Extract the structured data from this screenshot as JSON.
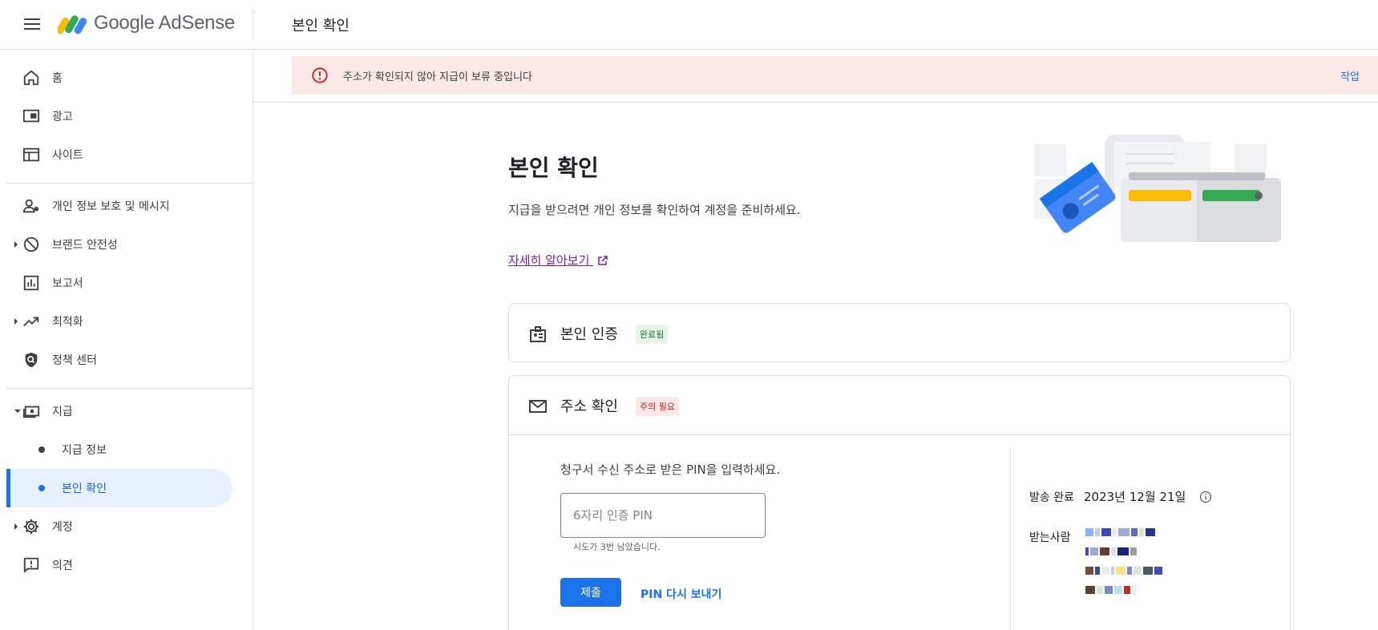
{
  "header": {
    "brand": "Google AdSense",
    "page_title": "본인 확인"
  },
  "sidebar": {
    "items": [
      {
        "label": "홈",
        "icon": "home-icon"
      },
      {
        "label": "광고",
        "icon": "ads-icon"
      },
      {
        "label": "사이트",
        "icon": "sites-icon"
      },
      {
        "label": "개인 정보 보호 및 메시지",
        "icon": "privacy-icon"
      },
      {
        "label": "브랜드 안전성",
        "icon": "block-icon"
      },
      {
        "label": "보고서",
        "icon": "reports-icon"
      },
      {
        "label": "최적화",
        "icon": "trending-icon"
      },
      {
        "label": "정책 센터",
        "icon": "policy-shield-icon"
      },
      {
        "label": "지급",
        "icon": "payments-icon"
      },
      {
        "label": "지급 정보"
      },
      {
        "label": "본인 확인"
      },
      {
        "label": "계정",
        "icon": "gear-icon"
      },
      {
        "label": "의견",
        "icon": "feedback-icon"
      }
    ]
  },
  "alert": {
    "text": "주소가 확인되지 않아 지급이 보류 중입니다",
    "action": "작업"
  },
  "main": {
    "title": "본인 확인",
    "description": "지급을 받으려면 개인 정보를 확인하여 계정을 준비하세요.",
    "learn_more": "자세히 알아보기"
  },
  "identity_card": {
    "title": "본인 인증",
    "badge": "완료됨"
  },
  "address_card": {
    "title": "주소 확인",
    "badge": "주의 필요",
    "pin_prompt": "청구서 수신 주소로 받은 PIN을 입력하세요.",
    "pin_placeholder": "6자리 인증 PIN",
    "pin_help": "시도가 3번 남았습니다.",
    "submit_label": "제출",
    "resend_label": "PIN 다시 보내기",
    "sent_label": "발송 완료",
    "sent_date": "2023년 12월 21일",
    "recipient_label": "받는사람"
  },
  "colors": {
    "primary": "#1a73e8",
    "alert_bg": "#fce8e6",
    "success_bg": "#e6f4ea",
    "success_text": "#137333",
    "error_text": "#c5221f"
  }
}
